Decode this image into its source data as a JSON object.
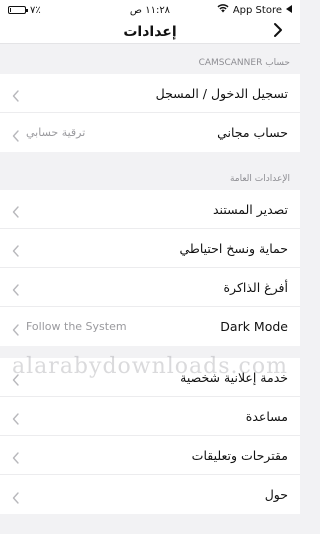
{
  "status_bar": {
    "carrier": "App Store",
    "time": "١١:٢٨ ص",
    "battery": "٧٪",
    "battery_fraction": 0.07
  },
  "nav": {
    "title": "إعدادات",
    "back_icon": "chevron-right-icon"
  },
  "sections": [
    {
      "header": "حساب CAMSCANNER",
      "rows": [
        {
          "label": "تسجيل الدخول / المسجل",
          "value": ""
        },
        {
          "label": "حساب مجاني",
          "value": "ترقية حسابي"
        }
      ]
    },
    {
      "header": "الإعدادات العامة",
      "rows": [
        {
          "label": "تصدير المستند",
          "value": ""
        },
        {
          "label": "حماية ونسخ احتياطي",
          "value": ""
        },
        {
          "label": "أفرغ الذاكرة",
          "value": ""
        },
        {
          "label": "Dark Mode",
          "value": "Follow the System"
        }
      ]
    },
    {
      "header": "",
      "rows": [
        {
          "label": "خدمة إعلانية شخصية",
          "value": ""
        },
        {
          "label": "مساعدة",
          "value": ""
        },
        {
          "label": "مقترحات وتعليقات",
          "value": ""
        },
        {
          "label": "حول",
          "value": ""
        }
      ]
    }
  ],
  "watermark": "alarabydownloads.com",
  "colors": {
    "background": "#f2f2f4",
    "row_background": "#ffffff",
    "secondary_text": "#8e8e93",
    "chevron": "#b8b8bc"
  }
}
